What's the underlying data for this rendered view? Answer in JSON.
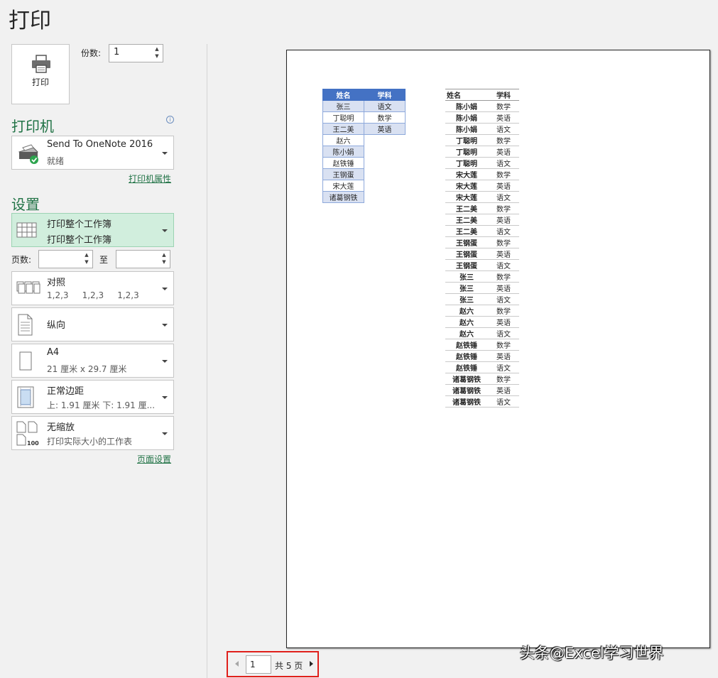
{
  "title": "打印",
  "print_button_label": "打印",
  "copies": {
    "label": "份数:",
    "value": "1"
  },
  "printer": {
    "heading": "打印机",
    "name": "Send To OneNote 2016",
    "status": "就绪",
    "properties_link": "打印机属性"
  },
  "settings": {
    "heading": "设置",
    "scope": {
      "line1": "打印整个工作簿",
      "line2": "打印整个工作簿"
    },
    "pages_label": "页数:",
    "pages_from": "",
    "to_label": "至",
    "pages_to": "",
    "collate": {
      "line1": "对照",
      "line2": "1,2,3     1,2,3     1,2,3"
    },
    "orientation": {
      "line1": "纵向"
    },
    "paper": {
      "line1": "A4",
      "line2": "21 厘米 x 29.7 厘米"
    },
    "margins": {
      "line1": "正常边距",
      "line2": "上: 1.91 厘米 下: 1.91 厘..."
    },
    "scaling": {
      "line1": "无缩放",
      "line2": "打印实际大小的工作表",
      "icon_text": "100"
    },
    "page_setup_link": "页面设置"
  },
  "preview": {
    "table1": {
      "headers": [
        "姓名",
        "学科"
      ],
      "col1": [
        "张三",
        "丁聪明",
        "王二美",
        "赵六",
        "陈小娟",
        "赵铁锤",
        "王钢蛋",
        "宋大莲",
        "诸葛钢铁"
      ],
      "col2": [
        "语文",
        "数学",
        "英语"
      ]
    },
    "table2": {
      "headers": [
        "姓名",
        "学科"
      ],
      "rows": [
        [
          "陈小娟",
          "数学"
        ],
        [
          "陈小娟",
          "英语"
        ],
        [
          "陈小娟",
          "语文"
        ],
        [
          "丁聪明",
          "数学"
        ],
        [
          "丁聪明",
          "英语"
        ],
        [
          "丁聪明",
          "语文"
        ],
        [
          "宋大莲",
          "数学"
        ],
        [
          "宋大莲",
          "英语"
        ],
        [
          "宋大莲",
          "语文"
        ],
        [
          "王二美",
          "数学"
        ],
        [
          "王二美",
          "英语"
        ],
        [
          "王二美",
          "语文"
        ],
        [
          "王钢蛋",
          "数学"
        ],
        [
          "王钢蛋",
          "英语"
        ],
        [
          "王钢蛋",
          "语文"
        ],
        [
          "张三",
          "数学"
        ],
        [
          "张三",
          "英语"
        ],
        [
          "张三",
          "语文"
        ],
        [
          "赵六",
          "数学"
        ],
        [
          "赵六",
          "英语"
        ],
        [
          "赵六",
          "语文"
        ],
        [
          "赵铁锤",
          "数学"
        ],
        [
          "赵铁锤",
          "英语"
        ],
        [
          "赵铁锤",
          "语文"
        ],
        [
          "诸葛钢铁",
          "数学"
        ],
        [
          "诸葛钢铁",
          "英语"
        ],
        [
          "诸葛钢铁",
          "语文"
        ]
      ]
    }
  },
  "pager": {
    "current": "1",
    "total": "共 5 页"
  },
  "watermark": "头条@Excel学习世界",
  "colors": {
    "accent": "#217346",
    "selected_bg": "#d1eedd",
    "header_blue": "#4472c4",
    "shade_blue": "#d9e1f2",
    "highlight_red": "#e0201b"
  }
}
